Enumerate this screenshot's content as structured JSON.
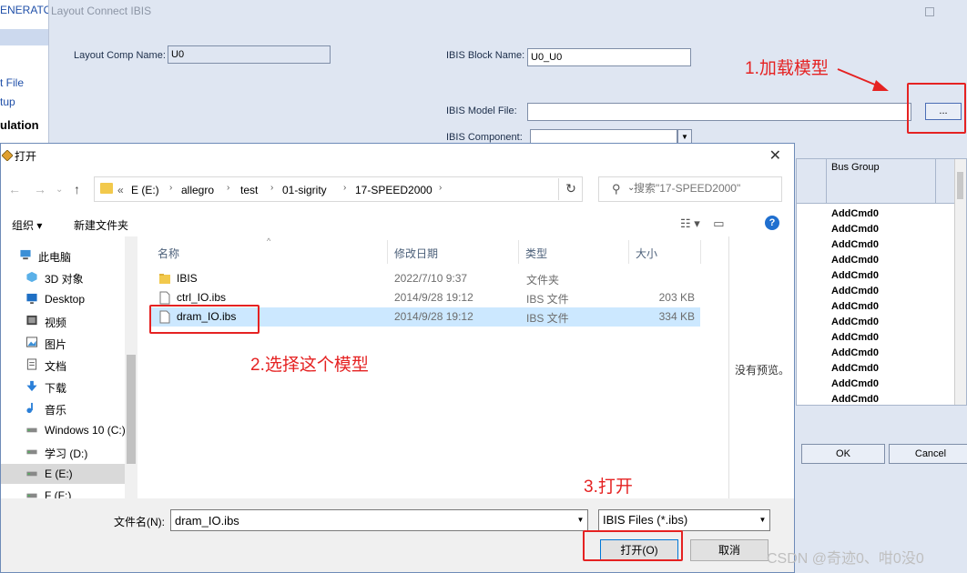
{
  "left_strip": {
    "generator": "ENERATOR",
    "item1": "t File",
    "item2": "tup",
    "simulation": "ulation"
  },
  "ibis_window": {
    "title": "Layout Connect IBIS",
    "layout_comp_name_label": "Layout Comp Name:",
    "layout_comp_name_value": "U0",
    "ibis_block_name_label": "IBIS Block Name:",
    "ibis_block_name_value": "U0_U0",
    "ibis_model_file_label": "IBIS Model File:",
    "ibis_model_file_value": "",
    "browse_label": "...",
    "ibis_component_label": "IBIS Component:",
    "bus_group_header": "Bus Group",
    "bus_rows": [
      "AddCmd0",
      "AddCmd0",
      "AddCmd0",
      "AddCmd0",
      "AddCmd0",
      "AddCmd0",
      "AddCmd0",
      "AddCmd0",
      "AddCmd0",
      "AddCmd0",
      "AddCmd0",
      "AddCmd0",
      "AddCmd0"
    ],
    "ok_label": "OK",
    "cancel_label": "Cancel"
  },
  "annotations": {
    "step1": "1.加载模型",
    "step2": "2.选择这个模型",
    "step3": "3.打开",
    "accent": "#e52222"
  },
  "dialog": {
    "title": "打开",
    "address": {
      "chevrons": "«",
      "crumbs": [
        "E (E:)",
        "allegro",
        "test",
        "01-sigrity",
        "17-SPEED2000"
      ]
    },
    "search_placeholder": "搜索\"17-SPEED2000\"",
    "toolbar": {
      "organize": "组织 ▾",
      "new_folder": "新建文件夹"
    },
    "nav_items": [
      {
        "label": "此电脑",
        "icon": "computer-icon"
      },
      {
        "label": "3D 对象",
        "icon": "cube-icon"
      },
      {
        "label": "Desktop",
        "icon": "desktop-icon"
      },
      {
        "label": "视频",
        "icon": "video-icon"
      },
      {
        "label": "图片",
        "icon": "picture-icon"
      },
      {
        "label": "文档",
        "icon": "document-icon"
      },
      {
        "label": "下载",
        "icon": "download-icon"
      },
      {
        "label": "音乐",
        "icon": "music-icon"
      },
      {
        "label": "Windows 10 (C:)",
        "icon": "drive-icon"
      },
      {
        "label": "学习 (D:)",
        "icon": "drive-icon"
      },
      {
        "label": "E (E:)",
        "icon": "drive-icon"
      },
      {
        "label": "F (F:)",
        "icon": "drive-icon"
      }
    ],
    "columns": {
      "name": "名称",
      "date": "修改日期",
      "type": "类型",
      "size": "大小"
    },
    "files": [
      {
        "name": "IBIS",
        "date": "2022/7/10 9:37",
        "type": "文件夹",
        "size": "",
        "icon": "folder-icon"
      },
      {
        "name": "ctrl_IO.ibs",
        "date": "2014/9/28 19:12",
        "type": "IBS 文件",
        "size": "203 KB",
        "icon": "file-icon"
      },
      {
        "name": "dram_IO.ibs",
        "date": "2014/9/28 19:12",
        "type": "IBS 文件",
        "size": "334 KB",
        "icon": "file-icon"
      }
    ],
    "no_preview": "没有预览。",
    "filename_label": "文件名(N):",
    "filename_value": "dram_IO.ibs",
    "filetype_value": "IBIS Files (*.ibs)",
    "open_label": "打开(O)",
    "cancel_label": "取消"
  },
  "watermark": "CSDN @奇迹0、咁0没0"
}
